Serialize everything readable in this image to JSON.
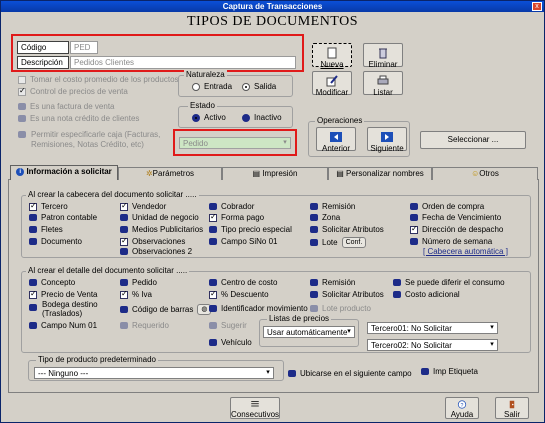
{
  "window": {
    "title": "Captura de Transacciones",
    "close": "x"
  },
  "heading": "TIPOS DE DOCUMENTOS",
  "codigo": {
    "label": "Código",
    "value": "PED"
  },
  "descripcion": {
    "label": "Descripción",
    "value": "Pedidos Clientes"
  },
  "options": {
    "tomar_costo": "Tomar el costo promedio de los productos",
    "control_precios": "Control de precios de venta",
    "factura_venta": "Es una factura de venta",
    "nota_credito": "Es una nota crédito de clientes",
    "permitir_caja_1": "Permitir especificarle caja (Facturas,",
    "permitir_caja_2": "Remisiones, Notas Crédito, etc)",
    "caja_value": "Pedido"
  },
  "naturaleza": {
    "title": "Naturaleza",
    "entrada": "Entrada",
    "salida": "Salida"
  },
  "estado": {
    "title": "Estado",
    "activo": "Activo",
    "inactivo": "Inactivo"
  },
  "buttons": {
    "nueva": "Nueva",
    "eliminar": "Eliminar",
    "modificar": "Modificar",
    "listar": "Listar",
    "anterior": "Anterior",
    "siguiente": "Siguiente",
    "seleccionar": "Seleccionar ...",
    "consecutivos": "Consecutivos",
    "ayuda": "Ayuda",
    "salir": "Salir",
    "conf": "Conf."
  },
  "operaciones": {
    "title": "Operaciones"
  },
  "tabs": [
    "Información a solicitar",
    "Parámetros",
    "Impresión",
    "Personalizar nombres",
    "Otros"
  ],
  "cabecera": {
    "title": "Al crear la cabecera del documento solicitar .....",
    "col1": [
      "Tercero",
      "Patron contable",
      "Fletes",
      "Documento"
    ],
    "col2": [
      "Vendedor",
      "Unidad de negocio",
      "Medios Publicitarios",
      "Observaciones",
      "Observaciones 2"
    ],
    "col3": [
      "Cobrador",
      "Forma pago",
      "Tipo precio especial",
      "Campo SiNo 01"
    ],
    "col4": [
      "Remisión",
      "Zona",
      "Solicitar Atributos",
      "Lote"
    ],
    "col5": [
      "Orden de compra",
      "Fecha de Vencimiento",
      "Dirección de despacho",
      "Número de semana",
      "[ Cabecera automática ]"
    ]
  },
  "detalle": {
    "title": "Al crear  el detalle del documento solicitar .....",
    "col1": [
      "Concepto",
      "Precio de Venta",
      "Bodega destino",
      "(Traslados)",
      "Campo Num 01"
    ],
    "col2": [
      "Pedido",
      "% Iva",
      "Código de barras",
      "Requerido"
    ],
    "col3": [
      "Centro de costo",
      "% Descuento",
      "Identificador movimiento",
      "Sugerir",
      "Vehículo"
    ],
    "col4": [
      "Remisión",
      "Solicitar Atributos",
      "Lote producto"
    ],
    "col5": [
      "Se puede diferir el consumo",
      "Costo adicional"
    ],
    "listas_title": "Listas de precios",
    "listas_value": "Usar automáticamente",
    "tercero01": "Tercero01: No Solicitar",
    "tercero02": "Tercero02: No Solicitar"
  },
  "tipo_producto": {
    "title": "Tipo de producto predeterminado",
    "value": "--- Ninguno ---",
    "ubicarse": "Ubicarse en el siguiente campo",
    "imp_etiqueta": "Imp Etiqueta"
  }
}
